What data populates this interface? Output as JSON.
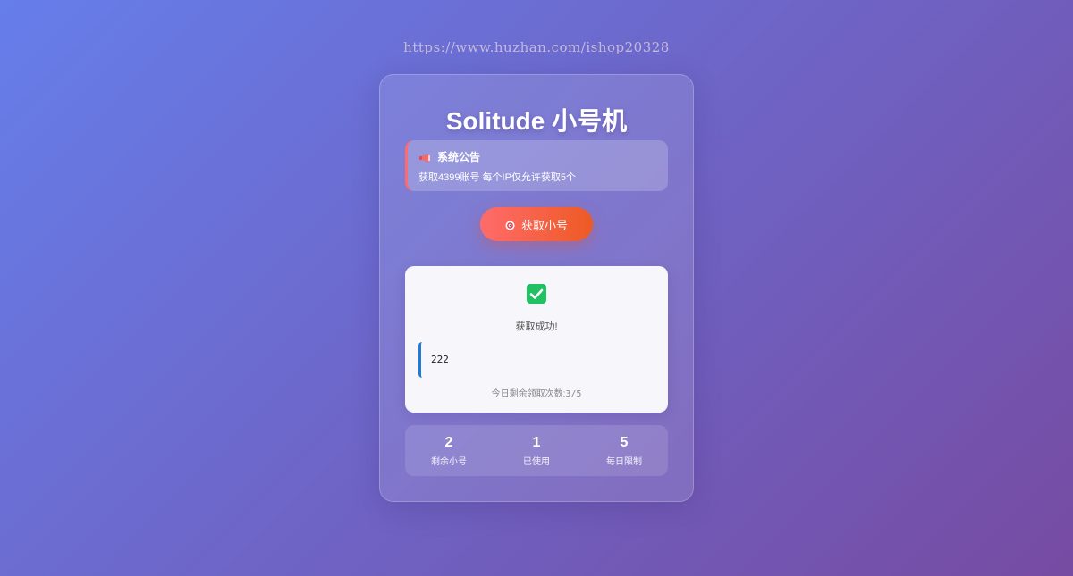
{
  "watermark": "https://www.huzhan.com/ishop20328",
  "app": {
    "title": "Solitude 小号机"
  },
  "notice": {
    "icon": "megaphone-icon",
    "heading": "系统公告",
    "text": "获取4399账号 每个IP仅允许获取5个"
  },
  "action": {
    "icon": "target-icon",
    "label": "获取小号"
  },
  "result": {
    "icon": "check-icon",
    "status": "获取成功!",
    "account": "222",
    "remaining_label": "今日剩余领取次数:",
    "remaining_value": "3/5"
  },
  "stats": [
    {
      "value": "2",
      "label": "剩余小号"
    },
    {
      "value": "1",
      "label": "已使用"
    },
    {
      "value": "5",
      "label": "每日限制"
    }
  ],
  "colors": {
    "background_start": "#667eea",
    "background_end": "#764ba2",
    "button_start": "#ff6b6b",
    "button_end": "#ee5a24",
    "success": "#21c063",
    "account_accent": "#1e7bd8"
  }
}
